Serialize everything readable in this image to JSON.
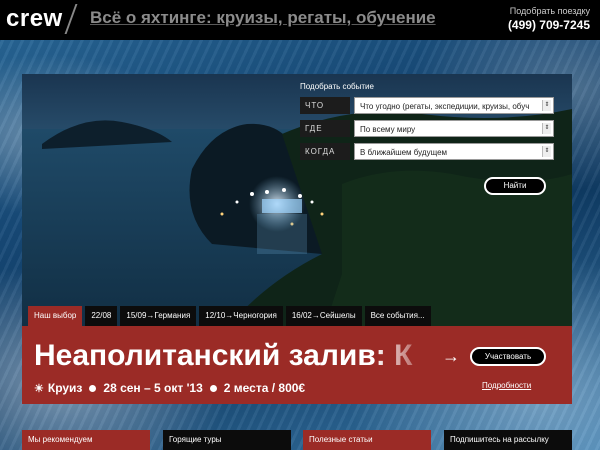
{
  "header": {
    "logo": "crew",
    "tagline": "Всё о яхтинге: круизы, регаты, обучение",
    "pick_trip_label": "Подобрать поездку",
    "phone": "(499) 709-7245"
  },
  "finder": {
    "title": "Подобрать событие",
    "fields": [
      {
        "label": "ЧТО",
        "value": "Что угодно (регаты, экспедиции, круизы, обуч"
      },
      {
        "label": "ГДЕ",
        "value": "По всему миру"
      },
      {
        "label": "КОГДА",
        "value": "В ближайшем будущем"
      }
    ],
    "button": "Найти"
  },
  "tabs": [
    {
      "label": "Наш выбор",
      "active": true
    },
    {
      "label": "22/08"
    },
    {
      "label": "15/09→Германия"
    },
    {
      "label": "12/10→Черногория"
    },
    {
      "label": "16/02→Сейшелы"
    },
    {
      "label": "Все события..."
    }
  ],
  "featured": {
    "headline": "Неаполитанский залив: К",
    "join_button": "Участвовать",
    "meta": {
      "type": "Круиз",
      "dates": "28 сен – 5 окт '13",
      "places": "2 места / 800€"
    },
    "details_link": "Подробности"
  },
  "columns": [
    "Мы рекомендуем",
    "Горящие туры",
    "Полезные статьи",
    "Подпишитесь на рассылку"
  ],
  "colors": {
    "accent": "#9b2b26",
    "header_bg": "#000000"
  }
}
